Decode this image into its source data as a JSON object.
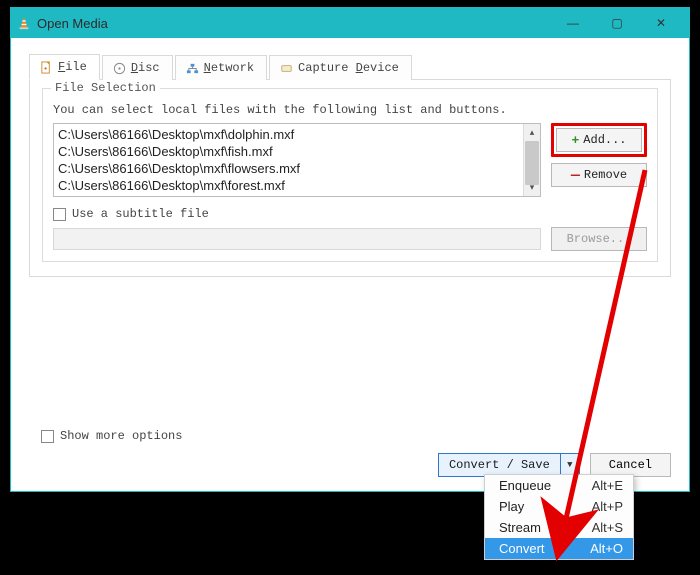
{
  "window": {
    "title": "Open Media"
  },
  "titlebar_buttons": {
    "minimize": "—",
    "maximize": "▢",
    "close": "✕"
  },
  "tabs": [
    {
      "label_pre": "",
      "underline": "F",
      "label_post": "ile"
    },
    {
      "label_pre": "",
      "underline": "D",
      "label_post": "isc"
    },
    {
      "label_pre": "",
      "underline": "N",
      "label_post": "etwork"
    },
    {
      "label_pre": "Capture ",
      "underline": "D",
      "label_post": "evice"
    }
  ],
  "group": {
    "title": "File Selection",
    "desc": "You can select local files with the following list and buttons."
  },
  "files": [
    "C:\\Users\\86166\\Desktop\\mxf\\dolphin.mxf",
    "C:\\Users\\86166\\Desktop\\mxf\\fish.mxf",
    "C:\\Users\\86166\\Desktop\\mxf\\flowsers.mxf",
    "C:\\Users\\86166\\Desktop\\mxf\\forest.mxf"
  ],
  "buttons": {
    "add": "Add...",
    "remove": "Remove",
    "browse": "Browse...",
    "convert_save": "Convert / Save",
    "cancel": "Cancel"
  },
  "checkboxes": {
    "subtitle": "Use a subtitle file",
    "more_options": "Show more options"
  },
  "menu": [
    {
      "label": "Enqueue",
      "shortcut": "Alt+E"
    },
    {
      "label": "Play",
      "shortcut": "Alt+P"
    },
    {
      "label": "Stream",
      "shortcut": "Alt+S"
    },
    {
      "label": "Convert",
      "shortcut": "Alt+O",
      "selected": true
    }
  ]
}
